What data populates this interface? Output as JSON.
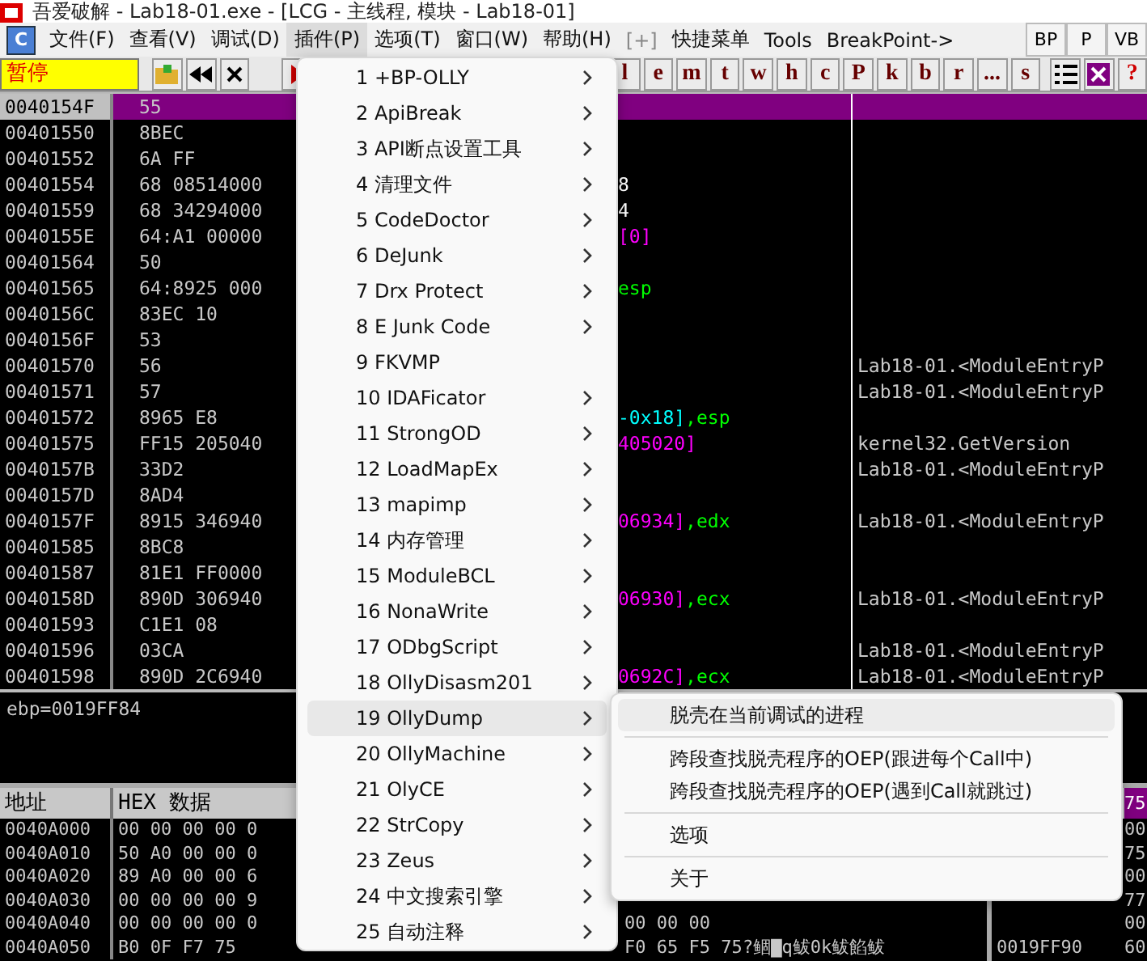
{
  "window": {
    "title": "吾爱破解 - Lab18-01.exe - [LCG - 主线程, 模块 - Lab18-01]"
  },
  "menubar": {
    "logo": "C",
    "items": [
      {
        "label": "文件(F)",
        "selected": false,
        "disabled": false
      },
      {
        "label": "查看(V)",
        "selected": false,
        "disabled": false
      },
      {
        "label": "调试(D)",
        "selected": false,
        "disabled": false
      },
      {
        "label": "插件(P)",
        "selected": true,
        "disabled": false
      },
      {
        "label": "选项(T)",
        "selected": false,
        "disabled": false
      },
      {
        "label": "窗口(W)",
        "selected": false,
        "disabled": false
      },
      {
        "label": "帮助(H)",
        "selected": false,
        "disabled": false
      },
      {
        "label": "[+]",
        "selected": false,
        "disabled": true
      },
      {
        "label": "快捷菜单",
        "selected": false,
        "disabled": false
      },
      {
        "label": "Tools",
        "selected": false,
        "disabled": false
      },
      {
        "label": "BreakPoint->",
        "selected": false,
        "disabled": false
      }
    ],
    "buttons": [
      "BP",
      "P",
      "VB"
    ]
  },
  "toolbar": {
    "status": "暂停",
    "letters": [
      "l",
      "e",
      "m",
      "t",
      "w",
      "h",
      "c",
      "P",
      "k",
      "b",
      "r",
      "...",
      "s"
    ],
    "help": "?"
  },
  "disasm": [
    {
      "address": "0040154F",
      "hex": "55",
      "selected": true
    },
    {
      "address": "00401550",
      "hex": "8BEC",
      "selected": false
    },
    {
      "address": "00401552",
      "hex": "6A FF",
      "selected": false
    },
    {
      "address": "00401554",
      "hex": "68 08514000",
      "selected": false,
      "tail": [
        {
          "text": "8",
          "kind": "imm"
        }
      ]
    },
    {
      "address": "00401559",
      "hex": "68 34294000",
      "selected": false,
      "tail": [
        {
          "text": "4",
          "kind": "imm"
        }
      ]
    },
    {
      "address": "0040155E",
      "hex": "64:A1 00000",
      "selected": false,
      "tail": [
        {
          "text": "[0]",
          "kind": "mem"
        }
      ]
    },
    {
      "address": "00401564",
      "hex": "50",
      "selected": false
    },
    {
      "address": "00401565",
      "hex": "64:8925 000",
      "selected": false,
      "tail": [
        {
          "text": "esp",
          "kind": "reg"
        }
      ]
    },
    {
      "address": "0040156C",
      "hex": "83EC 10",
      "selected": false
    },
    {
      "address": "0040156F",
      "hex": "53",
      "selected": false
    },
    {
      "address": "00401570",
      "hex": "56",
      "selected": false,
      "comment": "Lab18-01.<ModuleEntryP"
    },
    {
      "address": "00401571",
      "hex": "57",
      "selected": false,
      "comment": "Lab18-01.<ModuleEntryP"
    },
    {
      "address": "00401572",
      "hex": "8965 E8",
      "selected": false,
      "tail": [
        {
          "text": "-0x18]",
          "kind": "stack"
        },
        {
          "text": ",esp",
          "kind": "reg"
        }
      ]
    },
    {
      "address": "00401575",
      "hex": "FF15 205040",
      "selected": false,
      "tail": [
        {
          "text": "405020]",
          "kind": "mem"
        }
      ],
      "comment": "kernel32.GetVersion"
    },
    {
      "address": "0040157B",
      "hex": "33D2",
      "selected": false,
      "comment": "Lab18-01.<ModuleEntryP"
    },
    {
      "address": "0040157D",
      "hex": "8AD4",
      "selected": false
    },
    {
      "address": "0040157F",
      "hex": "8915 346940",
      "selected": false,
      "tail": [
        {
          "text": "06934]",
          "kind": "mem"
        },
        {
          "text": ",edx",
          "kind": "reg"
        }
      ],
      "comment": "Lab18-01.<ModuleEntryP"
    },
    {
      "address": "00401585",
      "hex": "8BC8",
      "selected": false
    },
    {
      "address": "00401587",
      "hex": "81E1 FF0000",
      "selected": false
    },
    {
      "address": "0040158D",
      "hex": "890D 306940",
      "selected": false,
      "tail": [
        {
          "text": "06930]",
          "kind": "mem"
        },
        {
          "text": ",ecx",
          "kind": "reg"
        }
      ],
      "comment": "Lab18-01.<ModuleEntryP"
    },
    {
      "address": "00401593",
      "hex": "C1E1 08",
      "selected": false
    },
    {
      "address": "00401596",
      "hex": "03CA",
      "selected": false,
      "comment": "Lab18-01.<ModuleEntryP"
    },
    {
      "address": "00401598",
      "hex": "890D 2C6940",
      "selected": false,
      "tail": [
        {
          "text": "0692C]",
          "kind": "mem"
        },
        {
          "text": ",ecx",
          "kind": "reg"
        }
      ],
      "comment": "Lab18-01.<ModuleEntryP"
    }
  ],
  "info": "ebp=0019FF84",
  "dump": {
    "columns": [
      "地址",
      "HEX 数据"
    ],
    "rows": [
      {
        "address": "0040A000",
        "hex": "00 00 00 00 0"
      },
      {
        "address": "0040A010",
        "hex": "50 A0 00 00 0"
      },
      {
        "address": "0040A020",
        "hex": "89 A0 00 00 6"
      },
      {
        "address": "0040A030",
        "hex": "00 00 00 00 9"
      },
      {
        "address": "0040A040",
        "hex": "00 00 00 00 0",
        "hex_right": "00 00 00"
      },
      {
        "address": "0040A050",
        "hex": "B0 0F F7 75",
        "hex_right": "F0 65 F5 75",
        "ascii": "?鲴▇q鲅0k鲅餡鲅"
      }
    ]
  },
  "stack": {
    "header": "75",
    "rows": [
      {
        "value": "00"
      },
      {
        "value": "75"
      },
      {
        "value": "00"
      },
      {
        "value": "77"
      },
      {
        "value": "00"
      },
      {
        "address": "0019FF90",
        "value": "60"
      }
    ]
  },
  "plugin_menu": [
    {
      "label": "1 +BP-OLLY",
      "has_submenu": true,
      "selected": false
    },
    {
      "label": "2 ApiBreak",
      "has_submenu": true,
      "selected": false
    },
    {
      "label": "3 API断点设置工具",
      "has_submenu": true,
      "selected": false
    },
    {
      "label": "4 清理文件",
      "has_submenu": true,
      "selected": false
    },
    {
      "label": "5 CodeDoctor",
      "has_submenu": true,
      "selected": false
    },
    {
      "label": "6 DeJunk",
      "has_submenu": true,
      "selected": false
    },
    {
      "label": "7 Drx Protect",
      "has_submenu": true,
      "selected": false
    },
    {
      "label": "8 E Junk Code",
      "has_submenu": true,
      "selected": false
    },
    {
      "label": "9 FKVMP",
      "has_submenu": false,
      "selected": false
    },
    {
      "label": "10 IDAFicator",
      "has_submenu": true,
      "selected": false
    },
    {
      "label": "11 StrongOD",
      "has_submenu": true,
      "selected": false
    },
    {
      "label": "12 LoadMapEx",
      "has_submenu": true,
      "selected": false
    },
    {
      "label": "13 mapimp",
      "has_submenu": true,
      "selected": false
    },
    {
      "label": "14 内存管理",
      "has_submenu": true,
      "selected": false
    },
    {
      "label": "15 ModuleBCL",
      "has_submenu": true,
      "selected": false
    },
    {
      "label": "16 NonaWrite",
      "has_submenu": true,
      "selected": false
    },
    {
      "label": "17 ODbgScript",
      "has_submenu": true,
      "selected": false
    },
    {
      "label": "18 OllyDisasm201",
      "has_submenu": true,
      "selected": false
    },
    {
      "label": "19 OllyDump",
      "has_submenu": true,
      "selected": true
    },
    {
      "label": "20 OllyMachine",
      "has_submenu": true,
      "selected": false
    },
    {
      "label": "21 OlyCE",
      "has_submenu": true,
      "selected": false
    },
    {
      "label": "22 StrCopy",
      "has_submenu": true,
      "selected": false
    },
    {
      "label": "23 Zeus",
      "has_submenu": true,
      "selected": false
    },
    {
      "label": "24 中文搜索引擎",
      "has_submenu": true,
      "selected": false
    },
    {
      "label": "25 自动注释",
      "has_submenu": true,
      "selected": false
    }
  ],
  "submenu": [
    {
      "label": "脱壳在当前调试的进程",
      "selected": true,
      "separator_after": true
    },
    {
      "label": "跨段查找脱壳程序的OEP(跟进每个Call中)",
      "selected": false,
      "separator_after": false
    },
    {
      "label": "跨段查找脱壳程序的OEP(遇到Call就跳过)",
      "selected": false,
      "separator_after": true
    },
    {
      "label": "选项",
      "selected": false,
      "separator_after": true
    },
    {
      "label": "关于",
      "selected": false,
      "separator_after": false
    }
  ]
}
